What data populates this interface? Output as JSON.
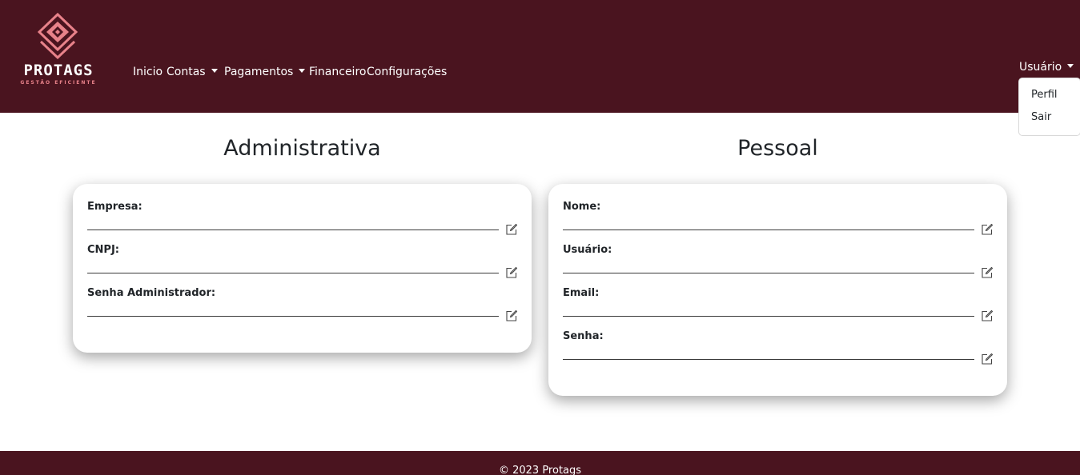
{
  "brand": {
    "name": "PROTAGS",
    "tagline": "GESTÃO EFICIENTE",
    "colors": {
      "navbar": "#4a141f",
      "accent": "#e8828a"
    },
    "icon": "diamond-logo-icon"
  },
  "nav": {
    "items": [
      {
        "label": "Inicio"
      },
      {
        "label": "Contas"
      },
      {
        "label": "Pagamentos"
      },
      {
        "label": "Financeiro"
      },
      {
        "label": "Configurações"
      }
    ]
  },
  "user_menu": {
    "label": "Usuário",
    "items": [
      {
        "label": "Perfil"
      },
      {
        "label": "Sair"
      }
    ]
  },
  "admin_section": {
    "title": "Administrativa",
    "fields": [
      {
        "label": "Empresa:",
        "value": ""
      },
      {
        "label": "CNPJ:",
        "value": ""
      },
      {
        "label": "Senha Administrador:",
        "value": ""
      }
    ]
  },
  "personal_section": {
    "title": "Pessoal",
    "fields": [
      {
        "label": "Nome:",
        "value": ""
      },
      {
        "label": "Usuário:",
        "value": ""
      },
      {
        "label": "Email:",
        "value": ""
      },
      {
        "label": "Senha:",
        "value": ""
      }
    ]
  },
  "icons": {
    "edit": "edit-pencil-icon"
  },
  "footer": {
    "text": "© 2023 Protags"
  }
}
